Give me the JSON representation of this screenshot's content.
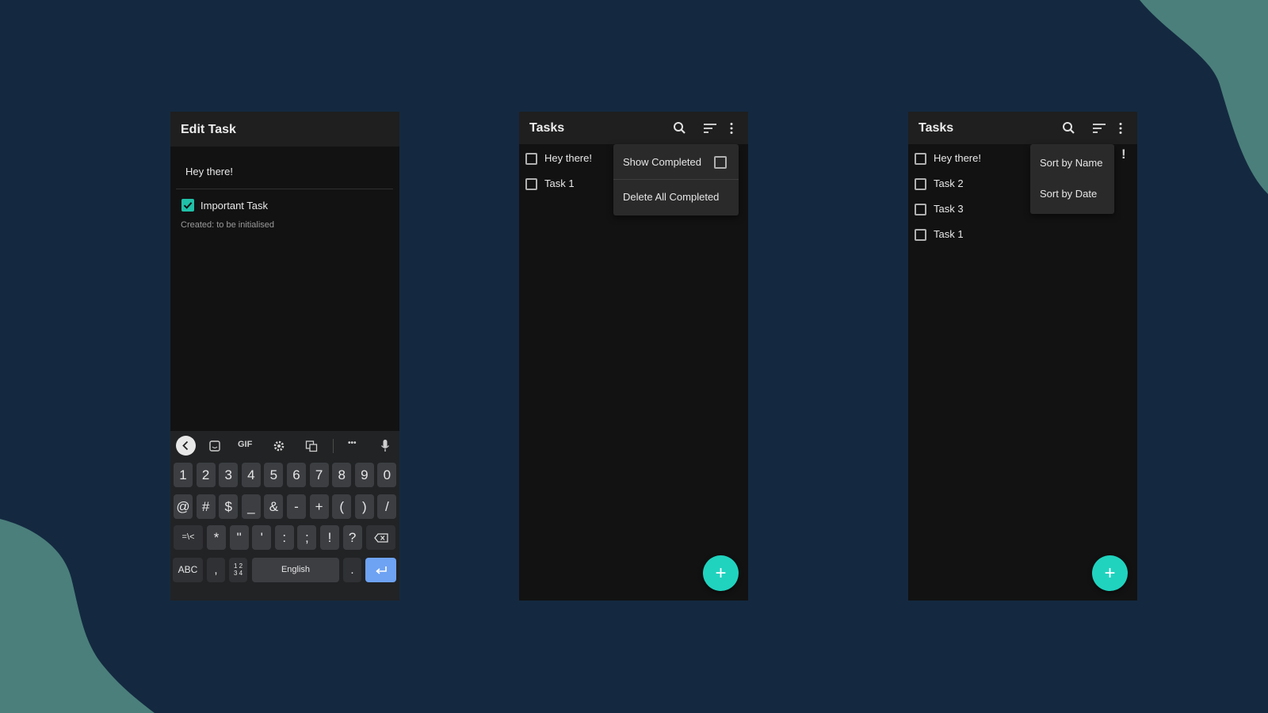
{
  "colors": {
    "background": "#142940",
    "blob": "#4b7f7b",
    "accent": "#20d3bf",
    "surface": "#121212",
    "appbar": "#1f1f1f"
  },
  "edit_screen": {
    "title": "Edit Task",
    "task_name_value": "Hey there!",
    "important_label": "Important Task",
    "important_checked": true,
    "created_text": "Created: to be initialised",
    "keyboard": {
      "toolbar": {
        "gif": "GIF",
        "more": "•••"
      },
      "row1": [
        "1",
        "2",
        "3",
        "4",
        "5",
        "6",
        "7",
        "8",
        "9",
        "0"
      ],
      "row2": [
        "@",
        "#",
        "$",
        "_",
        "&",
        "-",
        "+",
        "(",
        ")",
        "/"
      ],
      "row3": [
        "=\\<",
        "*",
        "\"",
        "'",
        ":",
        ";",
        "!",
        "?"
      ],
      "abc": "ABC",
      "comma": ",",
      "numpad": "1 2\n3 4",
      "space": "English",
      "period": "."
    }
  },
  "list_screen_menu": {
    "title": "Tasks",
    "tasks": [
      "Hey there!",
      "Task 1"
    ],
    "menu": {
      "show_completed": "Show Completed",
      "delete_all": "Delete All Completed"
    },
    "fab": "+"
  },
  "list_screen_sort": {
    "title": "Tasks",
    "tasks": [
      "Hey there!",
      "Task 2",
      "Task 3",
      "Task 1"
    ],
    "menu": {
      "sort_name": "Sort by Name",
      "sort_date": "Sort by Date"
    },
    "important_marker": "!",
    "fab": "+"
  }
}
